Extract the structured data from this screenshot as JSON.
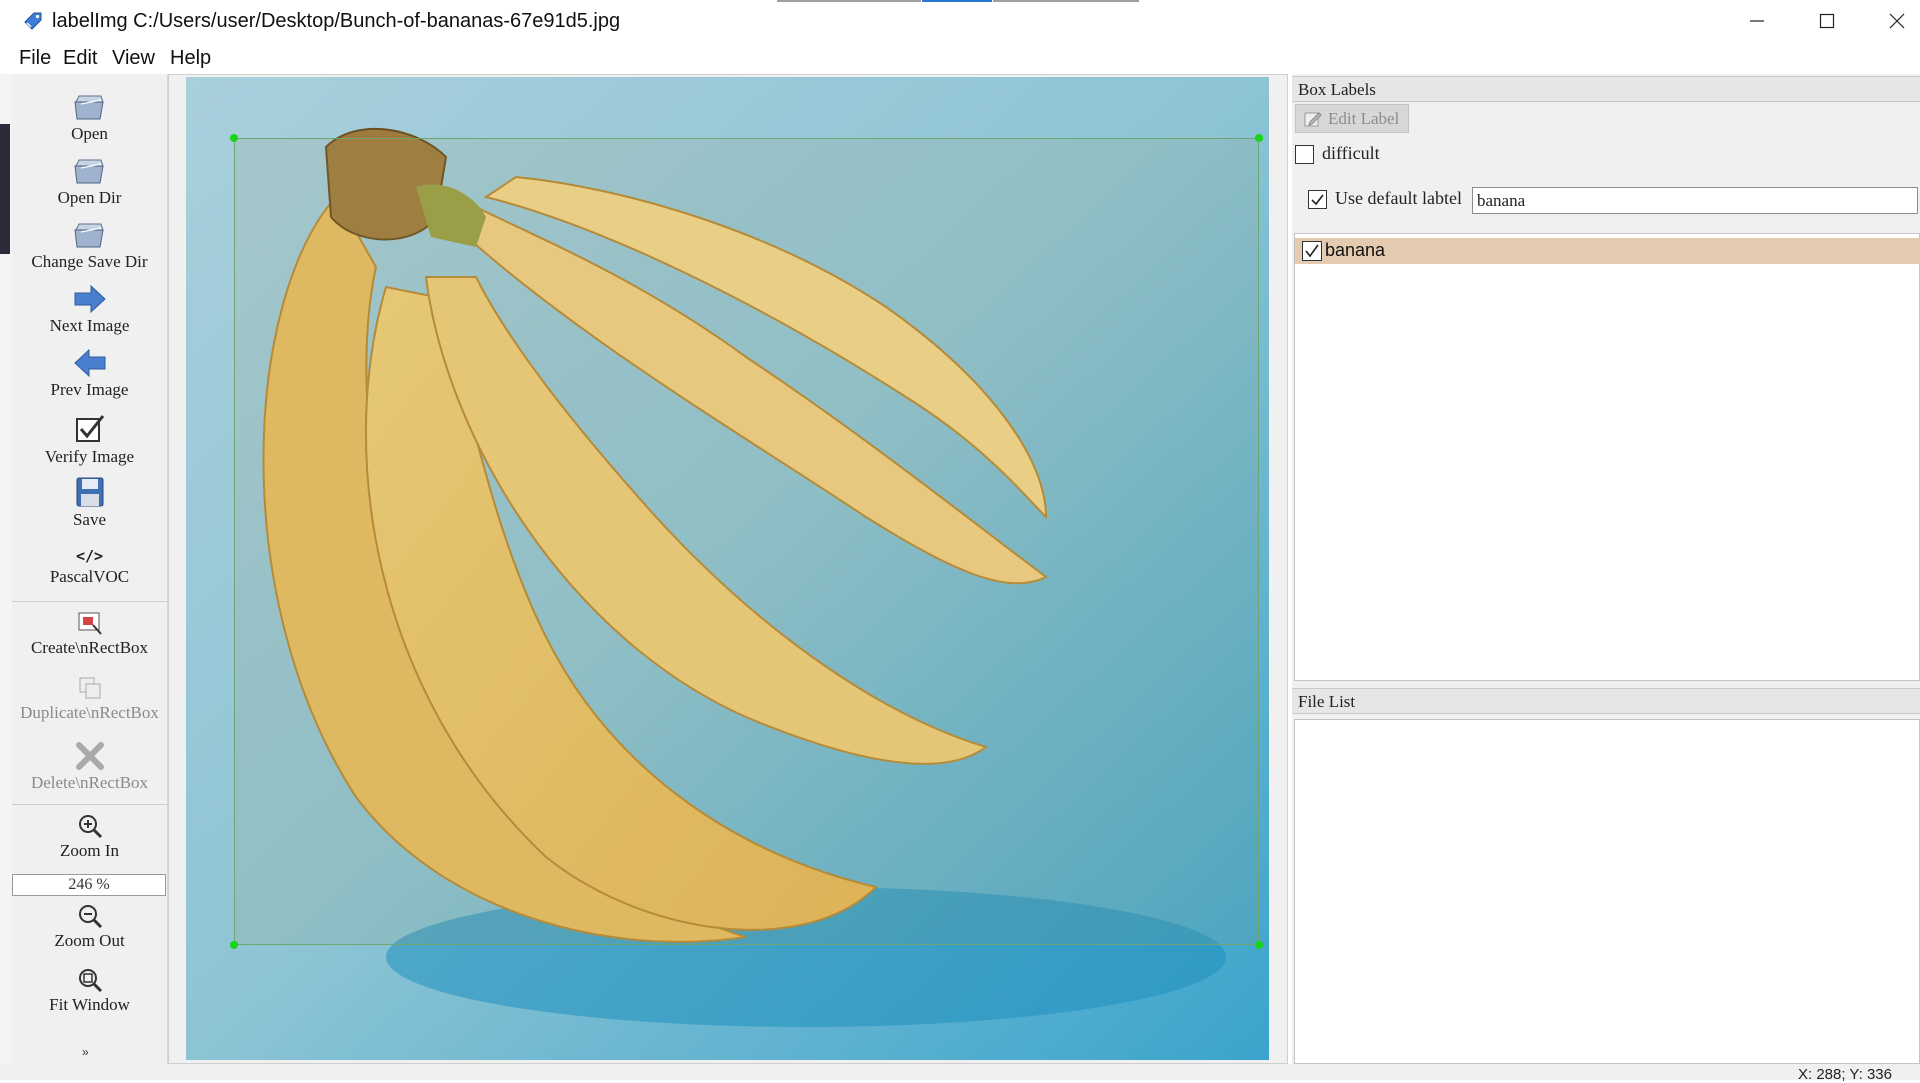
{
  "window": {
    "title": "labelImg C:/Users/user/Desktop/Bunch-of-bananas-67e91d5.jpg",
    "app_icon": "tag-icon",
    "controls": [
      "minimize-icon",
      "maximize-icon",
      "close-icon"
    ]
  },
  "menu": {
    "items": [
      "File",
      "Edit",
      "View",
      "Help"
    ]
  },
  "toolbar": {
    "open": "Open",
    "open_dir": "Open Dir",
    "change_save_dir": "Change Save Dir",
    "next_image": "Next Image",
    "prev_image": "Prev Image",
    "verify_image": "Verify Image",
    "save": "Save",
    "format": "PascalVOC",
    "format_icon_text": "</>",
    "create_rect": "Create\\nRectBox",
    "duplicate_rect": "Duplicate\\nRectBox",
    "delete_rect": "Delete\\nRectBox",
    "zoom_in": "Zoom In",
    "zoom_value": "246 %",
    "zoom_out": "Zoom Out",
    "fit_window": "Fit Window",
    "more": "»"
  },
  "canvas": {
    "image_subject": "bunch of bananas on blue background",
    "annotation_label": "banana",
    "box_color": "#17d617"
  },
  "box_labels": {
    "title": "Box Labels",
    "edit_label_button": "Edit Label",
    "difficult_label": "difficult",
    "difficult_checked": false,
    "use_default_label": "Use default labtel",
    "use_default_checked": true,
    "default_label_value": "banana",
    "items": [
      {
        "label": "banana",
        "checked": true,
        "highlight": "#e5cbaf"
      }
    ]
  },
  "file_list": {
    "title": "File List",
    "items": []
  },
  "status": {
    "text": "X: 288; Y: 336"
  }
}
